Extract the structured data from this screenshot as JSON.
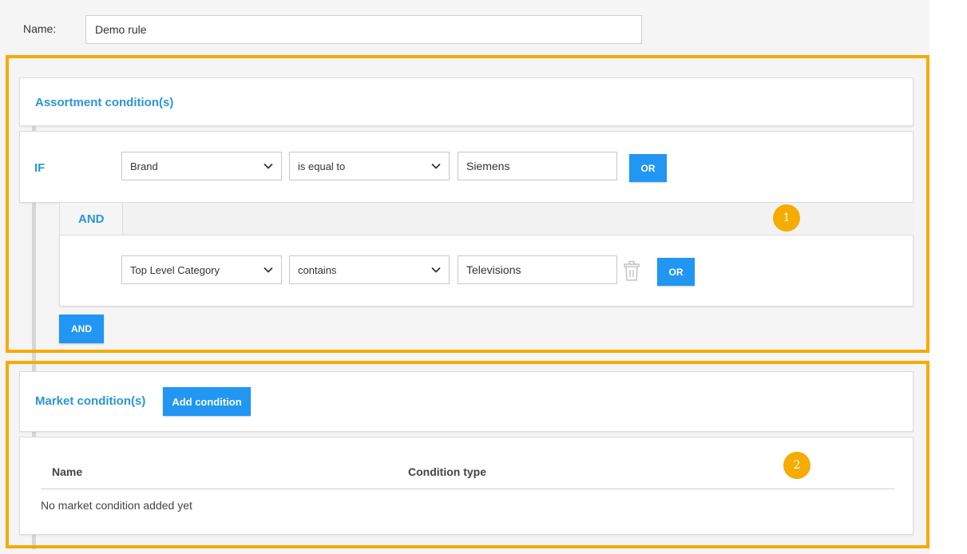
{
  "rule": {
    "name_label": "Name:",
    "name_value": "Demo rule"
  },
  "assortment": {
    "title": "Assortment condition(s)",
    "if_label": "IF",
    "and_label": "AND",
    "rows": [
      {
        "field": "Brand",
        "operator": "is equal to",
        "value": "Siemens",
        "or_label": "OR"
      },
      {
        "field": "Top Level Category",
        "operator": "contains",
        "value": "Televisions",
        "or_label": "OR"
      }
    ],
    "and_button": "AND",
    "badge": "1"
  },
  "market": {
    "title": "Market condition(s)",
    "add_button": "Add condition",
    "columns": [
      "Name",
      "Condition type"
    ],
    "empty_text": "No market condition added yet",
    "badge": "2"
  },
  "colors": {
    "accent_blue": "#2196f3",
    "title_blue": "#2b95d6",
    "highlight_orange": "#f5ab00"
  }
}
